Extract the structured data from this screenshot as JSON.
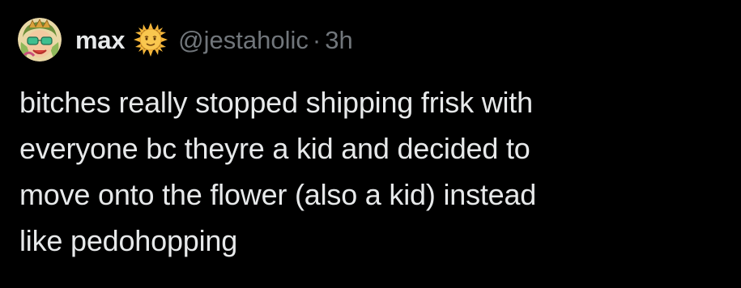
{
  "tweet": {
    "author": {
      "display_name": "max",
      "name_emoji": "sun-with-face-icon",
      "handle": "@jestaholic",
      "separator": "·",
      "time_ago": "3h",
      "avatar": "avatar"
    },
    "text": "bitches really stopped shipping frisk with\neveryone bc theyre a kid and decided to\nmove onto the flower (also a kid) instead\nlike pedohopping"
  },
  "colors": {
    "background": "#000000",
    "primary_text": "#e7e9ea",
    "secondary_text": "#71767b"
  }
}
